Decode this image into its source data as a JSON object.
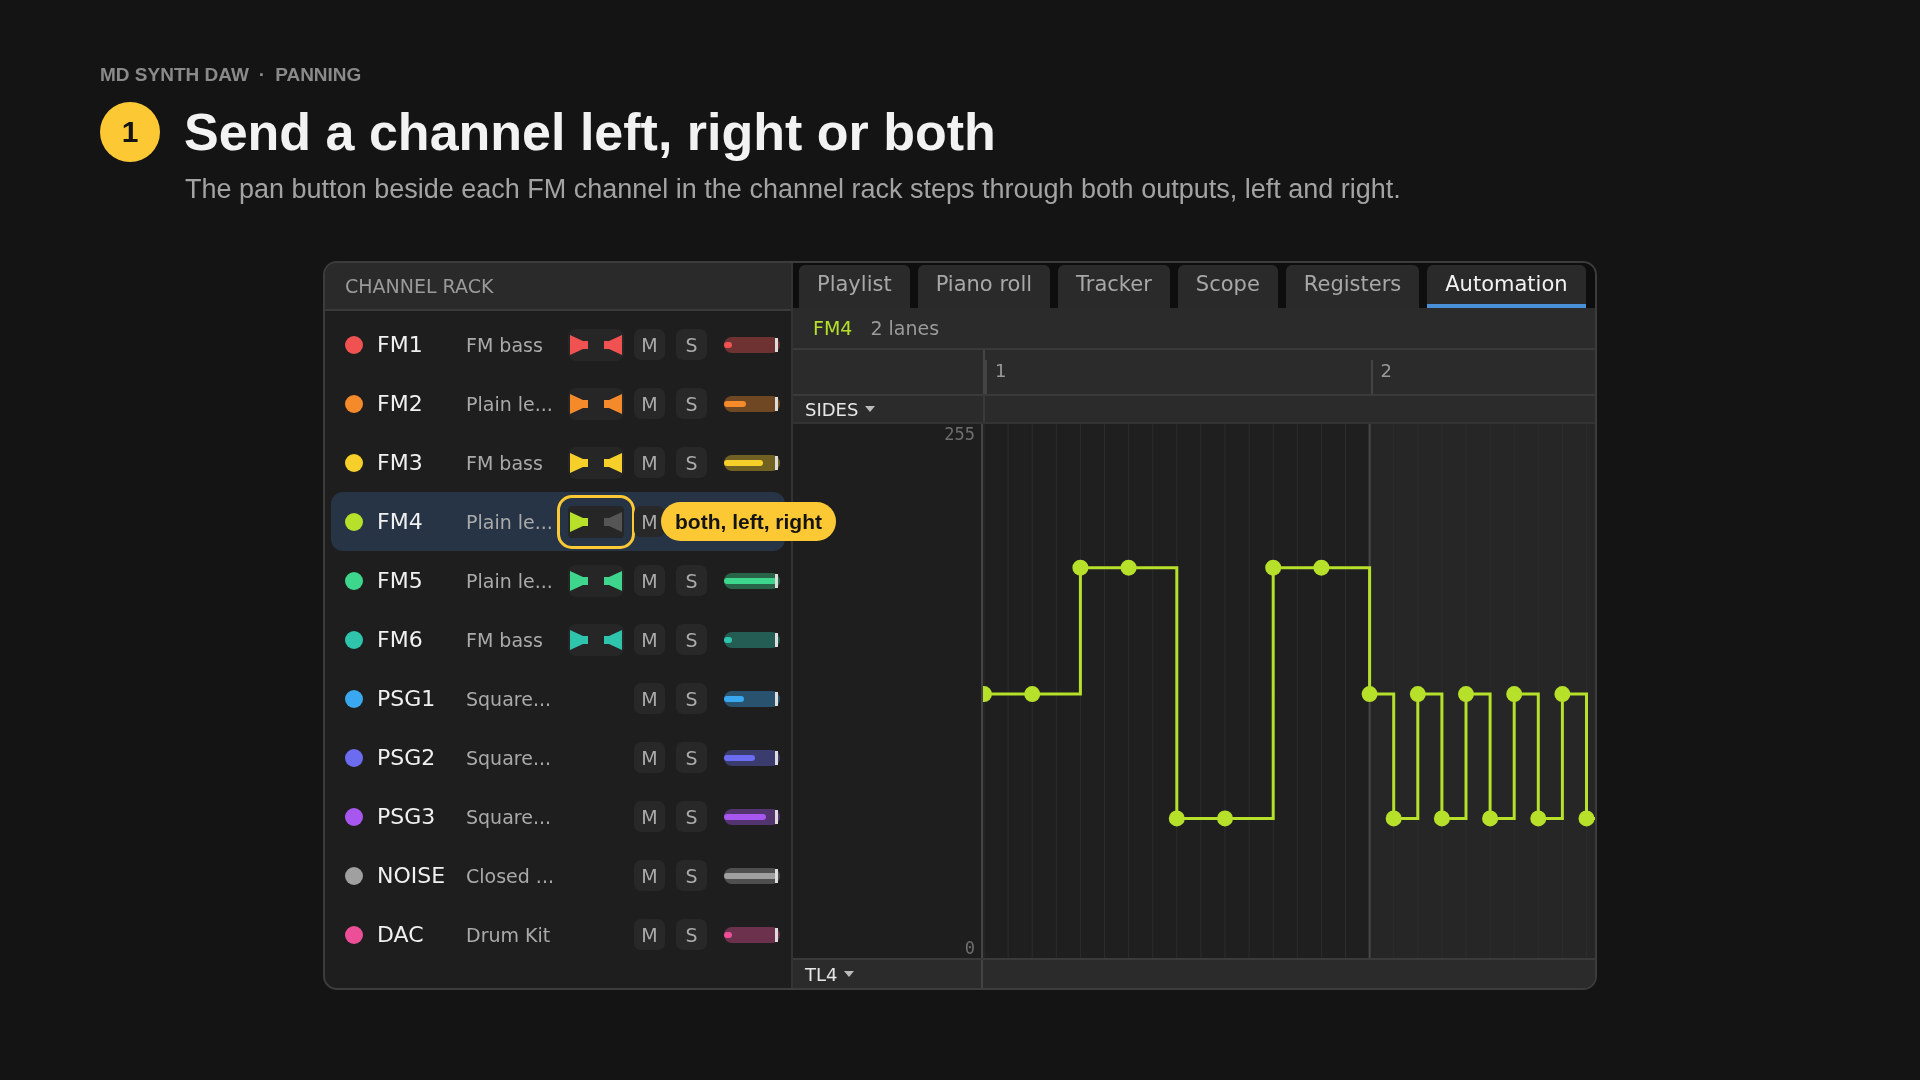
{
  "breadcrumb": {
    "items": [
      "MD SYNTH DAW",
      "PANNING"
    ],
    "separator": "·"
  },
  "step": {
    "number": "1",
    "title": "Send a channel left, right or both",
    "description": "The pan button beside each FM channel in the channel rack steps through both outputs, left and right."
  },
  "channel_rack": {
    "title": "CHANNEL RACK",
    "channels": [
      {
        "name": "FM1",
        "preset": "FM bass",
        "color": "#f05252",
        "kind": "fm",
        "left_on": true,
        "right_on": true,
        "selected": false,
        "mute": "M",
        "solo": "S",
        "level": 0.15
      },
      {
        "name": "FM2",
        "preset": "Plain le...",
        "color": "#f58a2a",
        "kind": "fm",
        "left_on": true,
        "right_on": true,
        "selected": false,
        "mute": "M",
        "solo": "S",
        "level": 0.4
      },
      {
        "name": "FM3",
        "preset": "FM bass",
        "color": "#f7cf2a",
        "kind": "fm",
        "left_on": true,
        "right_on": true,
        "selected": false,
        "mute": "M",
        "solo": "S",
        "level": 0.7
      },
      {
        "name": "FM4",
        "preset": "Plain le...",
        "color": "#b6e02a",
        "kind": "fm",
        "left_on": true,
        "right_on": false,
        "selected": true,
        "mute": "M",
        "tooltip": "both, left, right"
      },
      {
        "name": "FM5",
        "preset": "Plain le...",
        "color": "#3ed68c",
        "kind": "fm",
        "left_on": true,
        "right_on": true,
        "selected": false,
        "mute": "M",
        "solo": "S",
        "level": 0.95
      },
      {
        "name": "FM6",
        "preset": "FM bass",
        "color": "#2fc4ac",
        "kind": "fm",
        "left_on": true,
        "right_on": true,
        "selected": false,
        "mute": "M",
        "solo": "S",
        "level": 0.15
      },
      {
        "name": "PSG1",
        "preset": "Square...",
        "color": "#39a8f0",
        "kind": "psg",
        "selected": false,
        "mute": "M",
        "solo": "S",
        "level": 0.35
      },
      {
        "name": "PSG2",
        "preset": "Square...",
        "color": "#6b6cf0",
        "kind": "psg",
        "selected": false,
        "mute": "M",
        "solo": "S",
        "level": 0.55
      },
      {
        "name": "PSG3",
        "preset": "Square...",
        "color": "#a757f0",
        "kind": "psg",
        "selected": false,
        "mute": "M",
        "solo": "S",
        "level": 0.75
      },
      {
        "name": "NOISE",
        "preset": "Closed ...",
        "color": "#a0a0a0",
        "kind": "psg",
        "selected": false,
        "mute": "M",
        "solo": "S",
        "level": 0.95
      },
      {
        "name": "DAC",
        "preset": "Drum Kit",
        "color": "#ec4f98",
        "kind": "psg",
        "selected": false,
        "mute": "M",
        "solo": "S",
        "level": 0.15
      }
    ]
  },
  "tabs": [
    {
      "label": "Playlist",
      "selected": false
    },
    {
      "label": "Piano roll",
      "selected": false
    },
    {
      "label": "Tracker",
      "selected": false
    },
    {
      "label": "Scope",
      "selected": false
    },
    {
      "label": "Registers",
      "selected": false
    },
    {
      "label": "Automation",
      "selected": true
    }
  ],
  "automation": {
    "channel": "FM4",
    "lanes_count": "2 lanes",
    "bars": [
      "1",
      "2"
    ],
    "lanes": [
      {
        "label": "SIDES",
        "max_label": "255",
        "min_label": "0"
      },
      {
        "label": "TL4"
      }
    ]
  }
}
